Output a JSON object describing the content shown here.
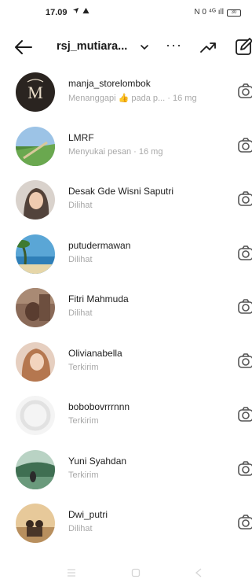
{
  "status": {
    "time": "17.09",
    "right_text": "N 0 ⁴ᴳ ıll",
    "battery": "30"
  },
  "header": {
    "account": "rsj_mutiara...",
    "more": "···"
  },
  "conversations": [
    {
      "name": "manja_storelombok",
      "sub_before": "Menanggapi",
      "sub_emoji": "👍",
      "sub_after": "pada p...",
      "time": "16 mg"
    },
    {
      "name": "LMRF",
      "sub_before": "Menyukai pesan",
      "time": "16 mg"
    },
    {
      "name": "Desak Gde Wisni Saputri",
      "sub_before": "Dilihat"
    },
    {
      "name": "putudermawan",
      "sub_before": "Dilihat"
    },
    {
      "name": "Fitri Mahmuda",
      "sub_before": "Dilihat"
    },
    {
      "name": "Olivianabella",
      "sub_before": "Terkirim"
    },
    {
      "name": "bobobovrrrnnn",
      "sub_before": "Terkirim"
    },
    {
      "name": "Yuni Syahdan",
      "sub_before": "Terkirim"
    },
    {
      "name": "Dwi_putri",
      "sub_before": "Dilihat"
    }
  ],
  "icons": {
    "back": "arrow-left-icon",
    "dropdown": "chevron-down-icon",
    "more": "more-horizontal-icon",
    "trending": "trending-up-icon",
    "compose": "edit-icon",
    "camera": "camera-icon"
  }
}
